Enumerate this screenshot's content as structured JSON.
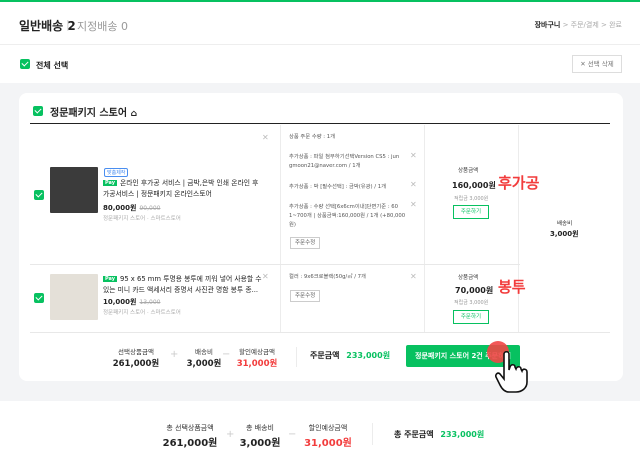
{
  "header": {
    "tab_main": "일반배송 2",
    "tab_sub": "지정배송 0",
    "steps": [
      "장바구니",
      "주문/결제",
      "완료"
    ]
  },
  "selection": {
    "select_all": "전체 선택",
    "delete_selected": "선택 삭제"
  },
  "store": {
    "name": "정문패키지 스토어",
    "shipping_label": "배송비",
    "shipping_value": "3,000원"
  },
  "items": [
    {
      "tag": "맞춤제작",
      "pay_badge": "Pay",
      "title": "온라인 후가공 서비스 | 금박,은박 인쇄 온라인 후가공서비스 | 정문패키지 온라인스토어",
      "price": "80,000원",
      "orig_price": "90,000",
      "seller": "정문패키지 스토어 · 스마트스토어",
      "options": [
        "상품 주문 수량 : 1개",
        "추가상품 : 파일 첨부하기선택Version CS5 : jun gmoon21@naver.com / 1개",
        "추가상품 : 박 [필수선택] : 금박(유광) / 1개",
        "추가상품 : 수량 선택[6x6cm이내]단면기준 : 60 1~700개 | 상품금액:160,000원 / 1개 (+80,000원)"
      ],
      "option_btn": "주문수정",
      "amount_label": "상품금액",
      "amount": "160,000원",
      "benefit": "적립금 3,000원",
      "order_btn": "주문하기",
      "note": "후가공"
    },
    {
      "pay_badge": "Pay",
      "title": "95 x 65 mm 투명용 봉투에 끼워 넣어 사용할 수 있는 미니 카드 액세서리 증명서 사진관 명함 봉투 종...",
      "price": "10,000원",
      "orig_price": "13,000",
      "seller": "정문패키지 스토어 · 스마트스토어",
      "options": [
        "컬러 : 9x6크로블랙(50g/㎡ / 7개"
      ],
      "option_btn": "주문수정",
      "amount_label": "상품금액",
      "amount": "70,000원",
      "benefit": "적립금 3,000원",
      "order_btn": "주문하기",
      "note": "봉투"
    }
  ],
  "store_summary": {
    "selected_label": "선택상품금액",
    "selected_value": "261,000원",
    "shipping_label": "배송비",
    "shipping_value": "3,000원",
    "discount_label": "할인예상금액",
    "discount_value": "31,000원",
    "order_label": "주문금액",
    "order_value": "233,000원",
    "order_button": "정문패키지 스토어 2건 주문하기"
  },
  "total_summary": {
    "selected_label": "총 선택상품금액",
    "selected_value": "261,000원",
    "shipping_label": "총 배송비",
    "shipping_value": "3,000원",
    "discount_label": "할인예상금액",
    "discount_value": "31,000원",
    "order_label": "총 주문금액",
    "order_value": "233,000원"
  },
  "colors": {
    "accent": "#07c160",
    "discount": "#f23c3c"
  }
}
